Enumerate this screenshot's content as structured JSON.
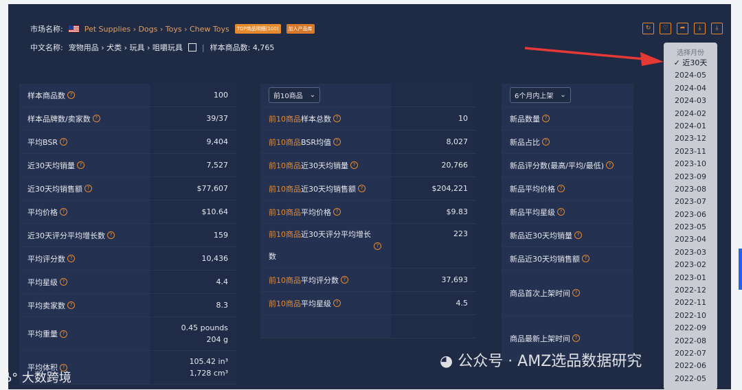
{
  "header": {
    "market_label": "市场名称:",
    "breadcrumb": "Pet Supplies › Dogs › Toys › Chew Toys",
    "badge_top": "TOP商品明细(100)",
    "badge_add": "加入产品库",
    "cn_label": "中文名称:",
    "cn_name": "宠物用品 › 犬类 › 玩具 › 咀嚼玩具",
    "sample_count": "样本商品数: 4,765"
  },
  "toolbar_icons": [
    "refresh-icon",
    "heart-icon",
    "share-icon",
    "download-icon",
    "download-alt-icon"
  ],
  "col1": {
    "rows": [
      {
        "label": "样本商品数",
        "value": "100"
      },
      {
        "label": "样本品牌数/卖家数",
        "value": "39/37"
      },
      {
        "label": "平均BSR",
        "value": "9,404"
      },
      {
        "label": "近30天均销量",
        "value": "7,527"
      },
      {
        "label": "近30天均销售额",
        "value": "$77,607"
      },
      {
        "label": "平均价格",
        "value": "$10.64"
      },
      {
        "label": "近30天评分平均增长数",
        "value": "159"
      },
      {
        "label": "平均评分数",
        "value": "10,436"
      },
      {
        "label": "平均星级",
        "value": "4.4"
      },
      {
        "label": "平均卖家数",
        "value": "8.3"
      },
      {
        "label": "平均重量",
        "value": "0.45 pounds",
        "value2": "204 g"
      },
      {
        "label": "平均体积",
        "value": "105.42 in³",
        "value2": "1,728 cm³"
      }
    ]
  },
  "col2": {
    "select": "前10商品",
    "prefix": "前10商品",
    "rows": [
      {
        "label": "样本总数",
        "value": "10"
      },
      {
        "label": "BSR均值",
        "value": "8,027"
      },
      {
        "label": "近30天均销量",
        "value": "20,766"
      },
      {
        "label": "近30天均销售额",
        "value": "$204,221"
      },
      {
        "label": "平均价格",
        "value": "$9.83"
      },
      {
        "label": "近30天评分平均增长数",
        "value": "223"
      },
      {
        "label": "平均评分数",
        "value": "37,693"
      },
      {
        "label": "平均星级",
        "value": "4.5"
      }
    ]
  },
  "col3": {
    "select": "6个月内上架",
    "rows": [
      {
        "label": "新品数量"
      },
      {
        "label": "新品占比"
      },
      {
        "label": "新品评分数(最高/平均/最低)"
      },
      {
        "label": "新品平均价格"
      },
      {
        "label": "新品平均星级"
      },
      {
        "label": "新品近30天均销量"
      },
      {
        "label": "新品近30天均销售额"
      },
      {
        "label": "商品首次上架时间"
      },
      {
        "label": "商品最新上架时间"
      }
    ]
  },
  "month_dropdown": {
    "header": "选择月份",
    "items": [
      "近30天",
      "2024-05",
      "2024-04",
      "2024-03",
      "2024-02",
      "2024-01",
      "2023-12",
      "2023-11",
      "2023-10",
      "2023-09",
      "2023-08",
      "2023-07",
      "2023-06",
      "2023-05",
      "2023-04",
      "2023-03",
      "2023-02",
      "2023-01",
      "2022-12",
      "2022-11",
      "2022-10",
      "2022-09",
      "2022-08",
      "2022-07",
      "2022-06",
      "2022-05"
    ],
    "selected": "近30天"
  },
  "watermark": "公众号 · AMZ选品数据研究",
  "logo_text": "大数跨境",
  "colors": {
    "accent": "#e68a2e",
    "panel": "#1f2a44",
    "arrow": "#e53935"
  }
}
